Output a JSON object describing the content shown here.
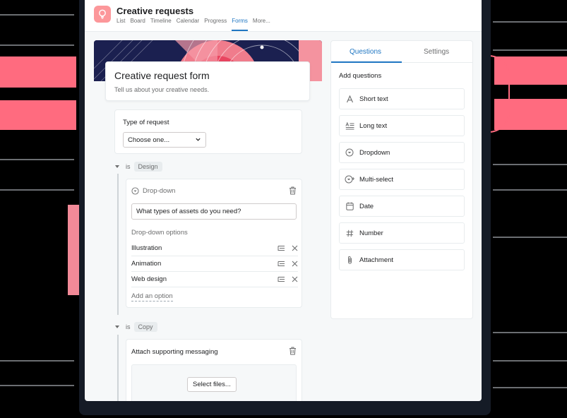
{
  "app": {
    "title": "Creative requests",
    "tabs": [
      "List",
      "Board",
      "Timeline",
      "Calendar",
      "Progress",
      "Forms",
      "More..."
    ],
    "active_tab": "Forms"
  },
  "form": {
    "title": "Creative request form",
    "subtitle": "Tell us about your creative needs.",
    "type_of_request": {
      "label": "Type of request",
      "value": "Choose one..."
    },
    "condition_design": {
      "op": "is",
      "value": "Design"
    },
    "dropdown_question": {
      "type_label": "Drop-down",
      "question": "What types of assets do you need?",
      "options_label": "Drop-down options",
      "options": [
        "Illustration",
        "Animation",
        "Web design"
      ],
      "add_option": "Add an option"
    },
    "condition_copy": {
      "op": "is",
      "value": "Copy"
    },
    "attachment_question": {
      "label": "Attach supporting messaging",
      "button": "Select files..."
    }
  },
  "panel": {
    "tabs": [
      "Questions",
      "Settings"
    ],
    "active_tab": "Questions",
    "heading": "Add questions",
    "items": [
      {
        "label": "Short text",
        "icon": "text-a-icon"
      },
      {
        "label": "Long text",
        "icon": "long-text-icon"
      },
      {
        "label": "Dropdown",
        "icon": "dropdown-icon"
      },
      {
        "label": "Multi-select",
        "icon": "multi-select-icon"
      },
      {
        "label": "Date",
        "icon": "calendar-icon"
      },
      {
        "label": "Number",
        "icon": "hash-icon"
      },
      {
        "label": "Attachment",
        "icon": "paperclip-icon"
      }
    ]
  },
  "colors": {
    "accent_blue": "#1f76c2",
    "brand_pink": "#fc979a",
    "hero_navy": "#1b2050",
    "decor_pink": "#ff6b7f"
  }
}
